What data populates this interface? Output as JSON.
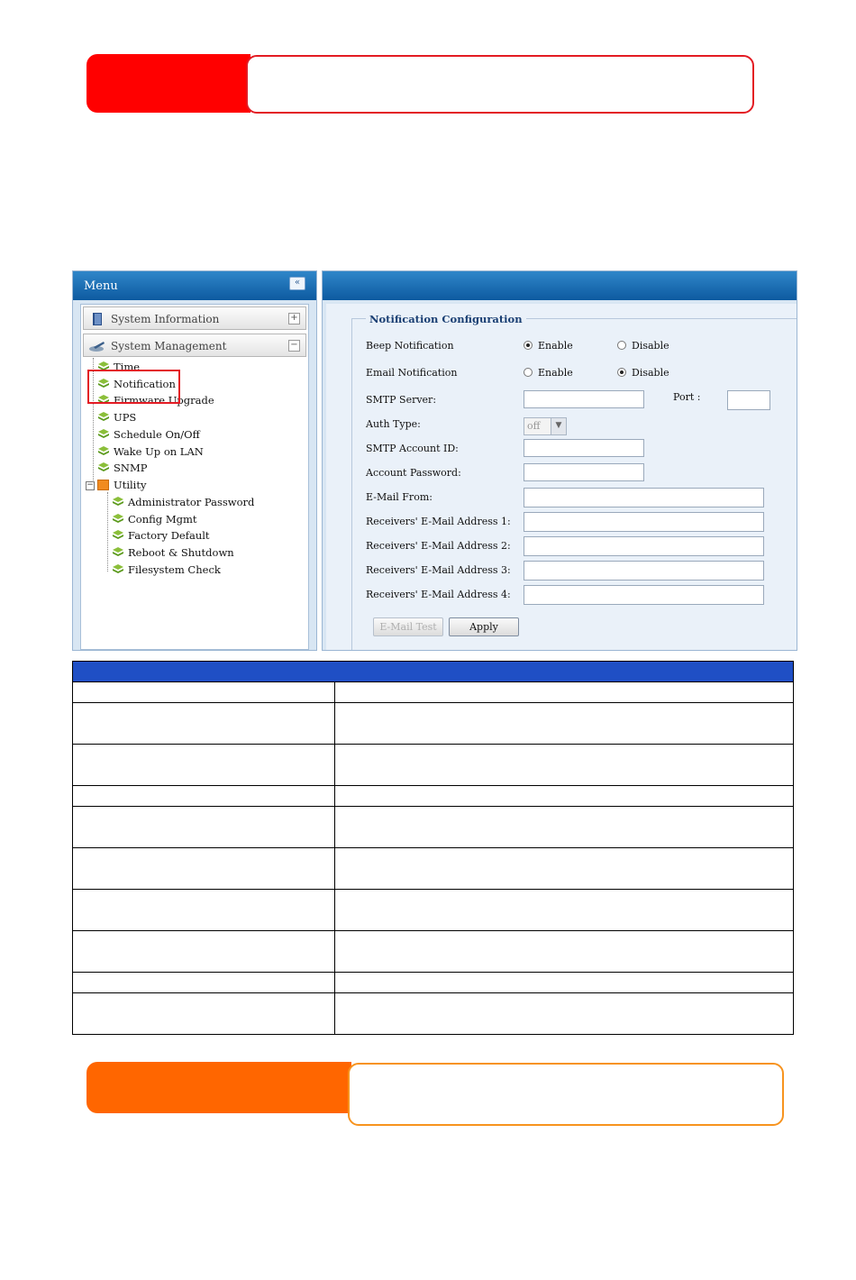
{
  "menu": {
    "title": "Menu",
    "collapse_icon": "«",
    "sections": [
      {
        "label": "System Information",
        "toggle": "+"
      },
      {
        "label": "System Management",
        "toggle": "−"
      }
    ],
    "items": [
      "Time",
      "Notification",
      "Firmware Upgrade",
      "UPS",
      "Schedule On/Off",
      "Wake Up on LAN",
      "SNMP"
    ],
    "utility": {
      "label": "Utility",
      "toggle": "−",
      "items": [
        "Administrator Password",
        "Config Mgmt",
        "Factory Default",
        "Reboot & Shutdown",
        "Filesystem Check"
      ]
    }
  },
  "config": {
    "legend": "Notification Configuration",
    "beep": {
      "label": "Beep Notification",
      "enable": "Enable",
      "disable": "Disable",
      "selected": "enable"
    },
    "email": {
      "label": "Email Notification",
      "enable": "Enable",
      "disable": "Disable",
      "selected": "disable"
    },
    "smtp_server": {
      "label": "SMTP Server:",
      "value": ""
    },
    "port": {
      "label": "Port :",
      "value": ""
    },
    "auth_type": {
      "label": "Auth Type:",
      "value": "off"
    },
    "smtp_account": {
      "label": "SMTP Account ID:",
      "value": ""
    },
    "account_password": {
      "label": "Account Password:",
      "value": ""
    },
    "email_from": {
      "label": "E-Mail From:",
      "value": ""
    },
    "receiver1": {
      "label": "Receivers' E-Mail Address 1:",
      "value": ""
    },
    "receiver2": {
      "label": "Receivers' E-Mail Address 2:",
      "value": ""
    },
    "receiver3": {
      "label": "Receivers' E-Mail Address 3:",
      "value": ""
    },
    "receiver4": {
      "label": "Receivers' E-Mail Address 4:",
      "value": ""
    },
    "buttons": {
      "test": "E-Mail Test",
      "apply": "Apply"
    }
  },
  "colors": {
    "banner_red": "#ff0000",
    "banner_orange": "#ff6600",
    "table_header": "#1f4fc5",
    "panel_blue": "#0d5aa0"
  }
}
